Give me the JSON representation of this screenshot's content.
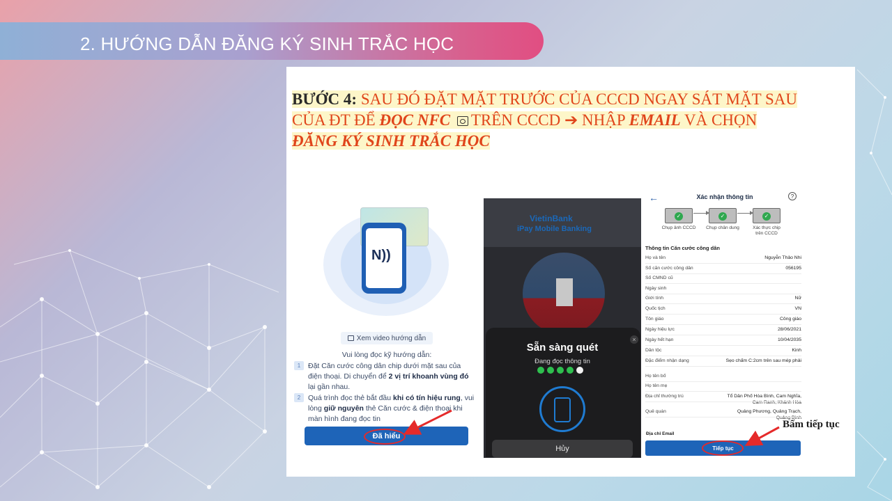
{
  "slide": {
    "title": "2. HƯỚNG DẪN ĐĂNG KÝ SINH TRẮC HỌC",
    "step": {
      "label": "BƯỚC 4:",
      "line1": "SAU ĐÓ ĐẶT MẶT TRƯỚC CỦA CCCD NGAY SÁT MẶT SAU",
      "line2_a": "CỦA ĐT ĐỂ",
      "line2_em": "ĐỌC NFC",
      "line2_b": "TRÊN CCCD",
      "arrow": "➔",
      "line2_c": "NHẬP",
      "line2_em2": "EMAIL",
      "line2_d": "VÀ CHỌN",
      "line3_em": "ĐĂNG KÝ SINH TRẮC HỌC"
    },
    "callout": "Bấm tiếp tục"
  },
  "screen1": {
    "nfc_glyph": "N))",
    "video_label": "Xem video hướng dẫn",
    "read_heading": "Vui lòng đọc kỹ hướng dẫn:",
    "items": [
      {
        "num": "1",
        "pre": "Đặt Căn cước công dân chip dưới mặt sau của điện thoại. Di chuyển để ",
        "bold": "2 vị trí khoanh vùng đó",
        "post": " lại gần nhau."
      },
      {
        "num": "2",
        "pre": "Quá trình đọc thẻ bắt đầu ",
        "bold": "khi có tín hiệu rung",
        "mid": ", vui lòng ",
        "bold2": "giữ nguyên",
        "post": " thẻ Căn cước & điện thoại khi màn hình đang đọc tin"
      }
    ],
    "button": "Đã hiểu"
  },
  "screen2": {
    "brand": "VietinBank",
    "app": "iPay Mobile Banking",
    "ready": "Sẵn sàng quét",
    "reading": "Đang đọc thông tin",
    "progress_done": 4,
    "progress_total": 5,
    "cancel": "Hủy",
    "close": "×"
  },
  "screen3": {
    "back": "←",
    "title": "Xác nhận thông tin",
    "help": "?",
    "steps": [
      "Chụp ảnh CCCD",
      "Chụp chân dung",
      "Xác thực chip trên CCCD"
    ],
    "section": "Thông tin Căn cước công dân",
    "rows": [
      {
        "k": "Họ và tên",
        "v": "Nguyễn Thảo Nhi"
      },
      {
        "k": "Số căn cước công dân",
        "v": "056195"
      },
      {
        "k": "Số CMND cũ",
        "v": ""
      },
      {
        "k": "Ngày sinh",
        "v": ""
      },
      {
        "k": "Giới tính",
        "v": "Nữ"
      },
      {
        "k": "Quốc tịch",
        "v": "VN"
      },
      {
        "k": "Tôn giáo",
        "v": "Công giáo"
      },
      {
        "k": "Ngày hiệu lực",
        "v": "28/06/2021"
      },
      {
        "k": "Ngày hết hạn",
        "v": "10/04/2035"
      },
      {
        "k": "Dân tộc",
        "v": "Kinh"
      },
      {
        "k": "Đặc điểm nhận dạng",
        "v": "Sẹo chấm C:2cm trên sau mép phải"
      },
      {
        "k": "Họ tên bố",
        "v": ""
      },
      {
        "k": "Họ tên mẹ",
        "v": ""
      },
      {
        "k": "Địa chỉ thường trú",
        "v": "Tổ Dân Phố Hòa Bình, Cam Nghĩa, Cam Ranh, Khánh Hòa"
      },
      {
        "k": "Quê quán",
        "v": "Quảng Phương, Quảng Trạch, Quảng Bình"
      }
    ],
    "partial": "Địa chỉ Email",
    "button": "Tiếp tục"
  },
  "colors": {
    "step_red": "#e0451b",
    "highlight": "#fdf6c9",
    "button_blue": "#1e64b8",
    "annotation_red": "#e52a2a",
    "title_gradient_end": "#e14e82"
  }
}
